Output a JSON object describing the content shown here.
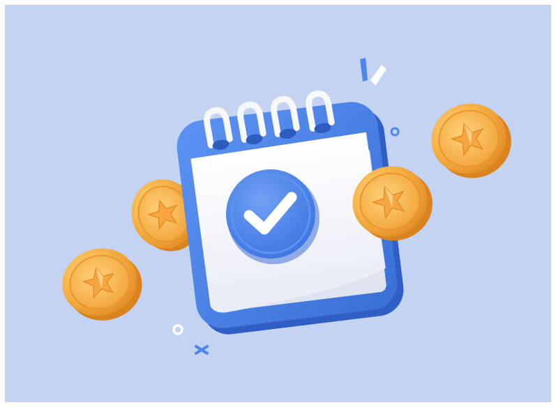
{
  "illustration": {
    "subject": "calendar-with-checkmark-and-star-coins",
    "colors": {
      "background": "#c4d3f1",
      "calendar_blue": "#4f86ea",
      "calendar_blue_dark": "#3a6fd6",
      "paper": "#f4f5fa",
      "coin_gold": "#f7b245",
      "coin_gold_dark": "#e59a2e",
      "star": "#fde0a0",
      "ring_white": "#f7f8fc"
    },
    "icons": [
      "calendar-icon",
      "checkmark-icon",
      "star-coin-icon",
      "sparkle-icon"
    ],
    "coin_count": 4
  }
}
